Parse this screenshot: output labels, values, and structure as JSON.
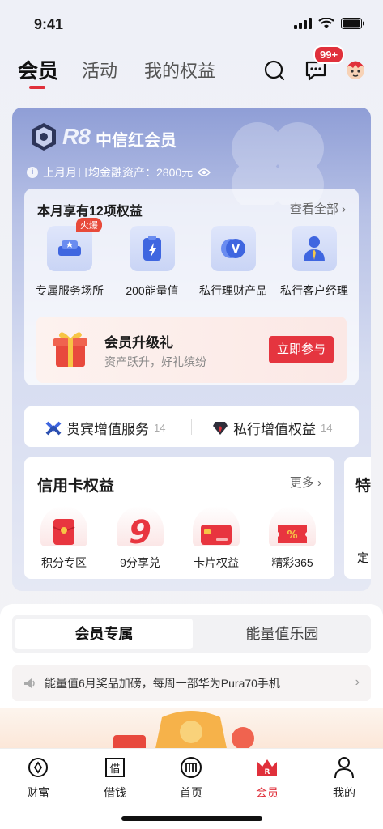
{
  "status_bar": {
    "time": "9:41"
  },
  "top_nav": {
    "tabs": [
      {
        "label": "会员"
      },
      {
        "label": "活动"
      },
      {
        "label": "我的权益"
      }
    ],
    "message_badge": "99+"
  },
  "member_card": {
    "level_code": "R8",
    "level_name": "中信红会员",
    "asset_label": "上月月日均金融资产：2800元",
    "benefits": {
      "title": "本月享有12项权益",
      "view_all": "查看全部 ›",
      "items": [
        {
          "label": "专属服务场所",
          "tag": "火爆"
        },
        {
          "label": "200能量值"
        },
        {
          "label": "私行理财产品"
        },
        {
          "label": "私行客户经理"
        }
      ]
    },
    "upgrade": {
      "title": "会员升级礼",
      "subtitle": "资产跃升，好礼缤纷",
      "button": "立即参与"
    },
    "services": [
      {
        "label": "贵宾增值服务",
        "count": "14"
      },
      {
        "label": "私行增值权益",
        "count": "14"
      }
    ],
    "credit": {
      "title": "信用卡权益",
      "more": "更多 ›",
      "items": [
        {
          "label": "积分专区"
        },
        {
          "label": "9分享兑"
        },
        {
          "label": "卡片权益"
        },
        {
          "label": "精彩365"
        }
      ]
    },
    "side_panel": {
      "title": "特",
      "label": "定"
    }
  },
  "lower": {
    "tabs": [
      {
        "label": "会员专属"
      },
      {
        "label": "能量值乐园"
      }
    ],
    "notice": "能量值6月奖品加磅，每周一部华为Pura70手机"
  },
  "bottom_nav": {
    "items": [
      {
        "label": "财富"
      },
      {
        "label": "借钱"
      },
      {
        "label": "首页"
      },
      {
        "label": "会员"
      },
      {
        "label": "我的"
      }
    ]
  },
  "colors": {
    "accent": "#e0303b",
    "card": "#8f9ed6"
  }
}
